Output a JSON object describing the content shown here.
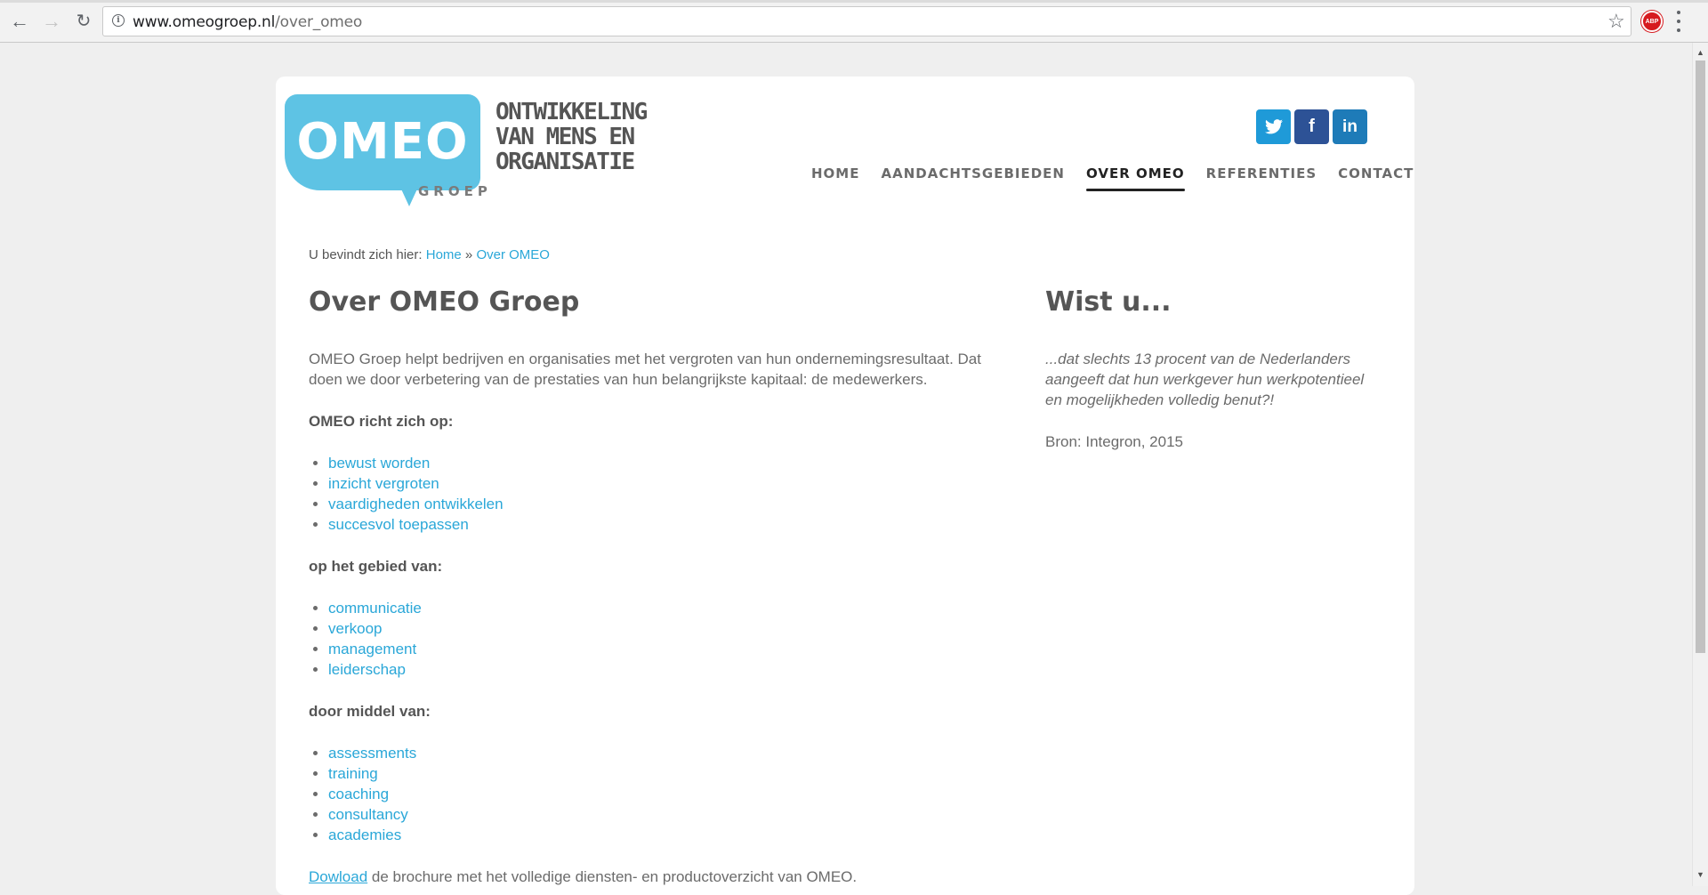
{
  "browser": {
    "url_domain": "www.omeogroep.nl",
    "url_path": "/over_omeo",
    "adblock_label": "ABP"
  },
  "logo": {
    "word": "OMEO",
    "sub": "GROEP",
    "tagline": [
      "ONTWIKKELING",
      "VAN MENS EN",
      "ORGANISATIE"
    ],
    "color": "#5ec3e4"
  },
  "social": {
    "twitter": "twitter-icon",
    "facebook": "f",
    "linkedin": "in"
  },
  "nav": {
    "items": [
      "HOME",
      "AANDACHTSGEBIEDEN",
      "OVER OMEO",
      "REFERENTIES",
      "CONTACT"
    ],
    "active": "OVER OMEO"
  },
  "breadcrumb": {
    "prefix": "U bevindt zich hier:",
    "home": "Home",
    "separator": "»",
    "current": "Over OMEO"
  },
  "main": {
    "title": "Over OMEO Groep",
    "intro": "OMEO Groep helpt bedrijven en organisaties met het vergroten van hun ondernemingsresultaat. Dat doen we door verbetering van de prestaties van hun belangrijkste kapitaal: de medewerkers.",
    "section1_heading": "OMEO richt zich op:",
    "section1_items": [
      "bewust worden",
      "inzicht vergroten",
      "vaardigheden ontwikkelen",
      "succesvol toepassen"
    ],
    "section2_heading": "op het gebied van:",
    "section2_items": [
      "communicatie",
      "verkoop",
      "management",
      "leiderschap"
    ],
    "section3_heading": "door middel van:",
    "section3_items": [
      "assessments",
      "training",
      "coaching",
      "consultancy",
      "academies"
    ],
    "download_link": "Dowload",
    "download_text": " de brochure met het volledige diensten- en productoverzicht van OMEO."
  },
  "side": {
    "title": "Wist u...",
    "quote": "...dat slechts 13 procent van de Nederlanders aangeeft dat hun werkgever hun werkpotentieel en mogelijkheden volledig benut?!",
    "source": "Bron: Integron, 2015"
  },
  "colors": {
    "link": "#2aa7d8",
    "text": "#6b6b6b",
    "page_bg": "#efefef"
  }
}
